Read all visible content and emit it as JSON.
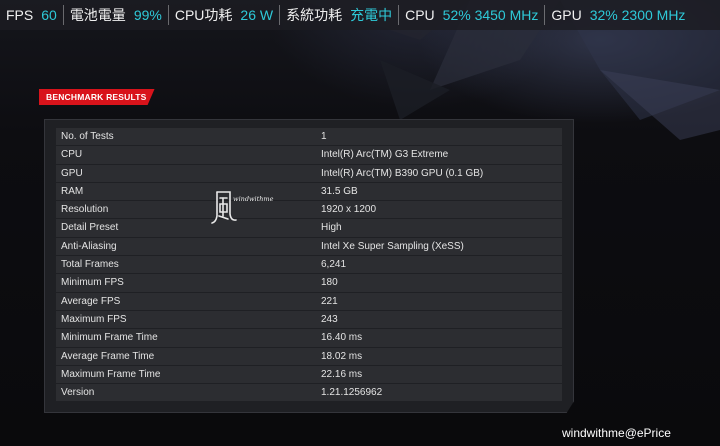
{
  "osd": {
    "fps_label": "FPS",
    "fps_value": "60",
    "battery_label": "電池電量",
    "battery_value": "99%",
    "cpu_power_label": "CPU功耗",
    "cpu_power_value": "26 W",
    "system_power_label": "系統功耗",
    "system_power_value": "充電中",
    "cpu_label": "CPU",
    "cpu_value": "52% 3450 MHz",
    "gpu_label": "GPU",
    "gpu_value": "32% 2300 MHz"
  },
  "benchmark": {
    "header": "BENCHMARK RESULTS",
    "rows": [
      {
        "key": "No. of Tests",
        "value": "1"
      },
      {
        "key": "CPU",
        "value": "Intel(R) Arc(TM) G3 Extreme"
      },
      {
        "key": "GPU",
        "value": "Intel(R) Arc(TM) B390 GPU (0.1 GB)"
      },
      {
        "key": "RAM",
        "value": "31.5 GB"
      },
      {
        "key": "Resolution",
        "value": "1920 x 1200"
      },
      {
        "key": "Detail Preset",
        "value": "High"
      },
      {
        "key": "Anti-Aliasing",
        "value": "Intel Xe Super Sampling (XeSS)"
      },
      {
        "key": "Total Frames",
        "value": "6,241"
      },
      {
        "key": "Minimum FPS",
        "value": "180"
      },
      {
        "key": "Average FPS",
        "value": "221"
      },
      {
        "key": "Maximum FPS",
        "value": "243"
      },
      {
        "key": "Minimum Frame Time",
        "value": "16.40 ms"
      },
      {
        "key": "Average Frame Time",
        "value": "18.02 ms"
      },
      {
        "key": "Maximum Frame Time",
        "value": "22.16 ms"
      },
      {
        "key": "Version",
        "value": "1.21.1256962"
      }
    ]
  },
  "watermark": {
    "logo_text": "windwithme"
  },
  "credit": "windwithme@ePrice",
  "colors": {
    "accent_value": "#2ec9d8",
    "tag_red": "#d8131b",
    "row_bg": "#2c2d31",
    "panel_bg": "#1f2024"
  }
}
